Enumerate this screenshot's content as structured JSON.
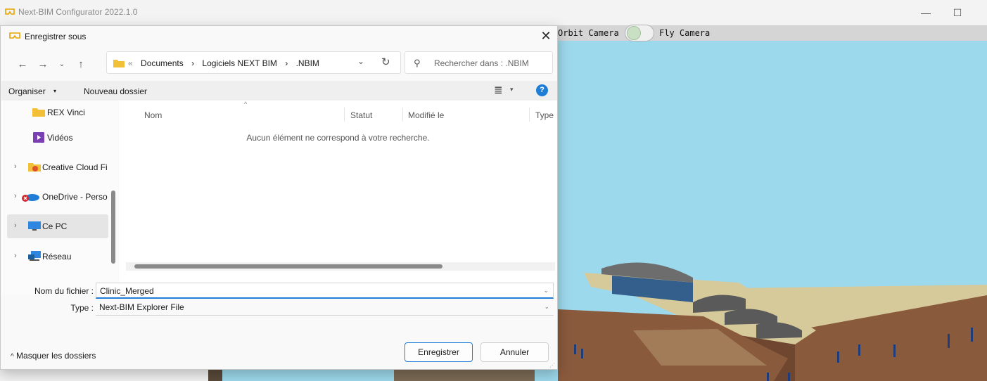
{
  "app": {
    "title": "Next-BIM Configurator 2022.1.0",
    "minimize_icon": "minimize-icon",
    "maximize_icon": "maximize-icon"
  },
  "camera": {
    "orbit_label": "Orbit Camera",
    "fly_label": "Fly Camera"
  },
  "dialog": {
    "title": "Enregistrer sous",
    "close_icon": "close-icon",
    "address": {
      "crumbs": [
        "Documents",
        "Logiciels NEXT BIM",
        ".NBIM"
      ],
      "separator": "›"
    },
    "search": {
      "placeholder": "Rechercher dans : .NBIM"
    },
    "commands": {
      "organise": "Organiser",
      "new_folder": "Nouveau dossier"
    },
    "nav_items": [
      {
        "label": "REX Vinci",
        "icon": "folder-icon",
        "chevron": false
      },
      {
        "label": "Vidéos",
        "icon": "videos-icon",
        "chevron": false
      },
      {
        "label": "Creative Cloud Fi",
        "icon": "creative-cloud-icon",
        "chevron": true
      },
      {
        "label": "OneDrive - Perso",
        "icon": "onedrive-icon",
        "chevron": true
      },
      {
        "label": "Ce PC",
        "icon": "computer-icon",
        "chevron": true
      },
      {
        "label": "Réseau",
        "icon": "network-icon",
        "chevron": true
      }
    ],
    "columns": [
      "Nom",
      "Statut",
      "Modifié le",
      "Type"
    ],
    "empty_message": "Aucun élément ne correspond à votre recherche.",
    "filename_label": "Nom du fichier :",
    "filename_value": "Clinic_Merged",
    "type_label": "Type :",
    "type_value": "Next-BIM Explorer File",
    "hide_folders": "Masquer les dossiers",
    "save_button": "Enregistrer",
    "cancel_button": "Annuler"
  },
  "colors": {
    "sky": "#9dd9ec",
    "accent": "#1e7dd7",
    "building_wall": "#8a5a3c",
    "roof": "#d6c99a"
  }
}
